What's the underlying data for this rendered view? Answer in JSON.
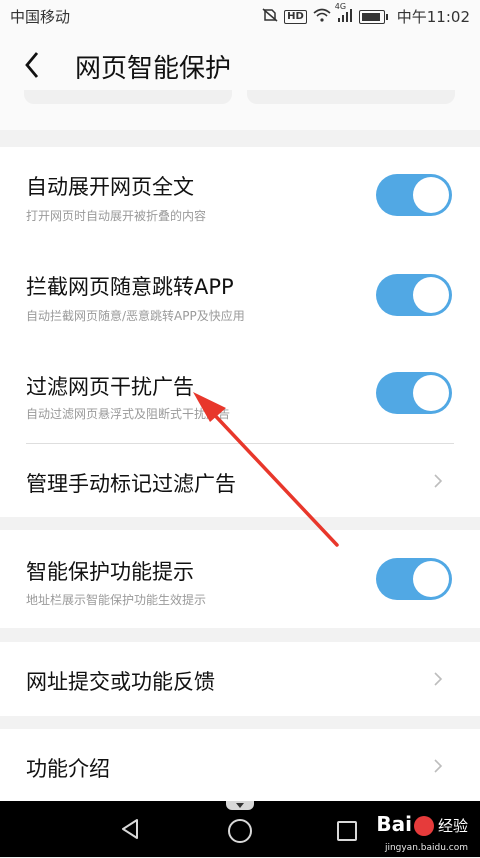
{
  "status_bar": {
    "carrier": "中国移动",
    "hd": "HD",
    "network": "4G",
    "time": "中午11:02",
    "icons": [
      "mute-icon",
      "hd-icon",
      "wifi-icon",
      "signal-4g-icon",
      "battery-icon"
    ]
  },
  "header": {
    "back_icon": "chevron-left-icon",
    "title": "网页智能保护"
  },
  "settings": [
    {
      "label": "自动展开网页全文",
      "description": "打开网页时自动展开被折叠的内容",
      "control": "toggle",
      "on": true
    },
    {
      "label": "拦截网页随意跳转APP",
      "description": "自动拦截网页随意/恶意跳转APP及快应用",
      "control": "toggle",
      "on": true
    },
    {
      "label": "过滤网页干扰广告",
      "description": "自动过滤网页悬浮式及阻断式干扰广告",
      "control": "toggle",
      "on": true
    },
    {
      "label": "管理手动标记过滤广告",
      "control": "chevron"
    },
    {
      "label": "智能保护功能提示",
      "description": "地址栏展示智能保护功能生效提示",
      "control": "toggle",
      "on": true
    },
    {
      "label": "网址提交或功能反馈",
      "control": "chevron"
    },
    {
      "label": "功能介绍",
      "control": "chevron"
    }
  ],
  "colors": {
    "toggle_on": "#51a8e4",
    "annotation_arrow": "#e8372b",
    "background": "#f2f2f2"
  },
  "nav_bar": {
    "icons": [
      "nav-back-icon",
      "nav-home-icon",
      "nav-recent-icon"
    ]
  },
  "watermark": {
    "brand_left": "Bai",
    "brand_right": "经验",
    "url": "jingyan.baidu.com"
  }
}
